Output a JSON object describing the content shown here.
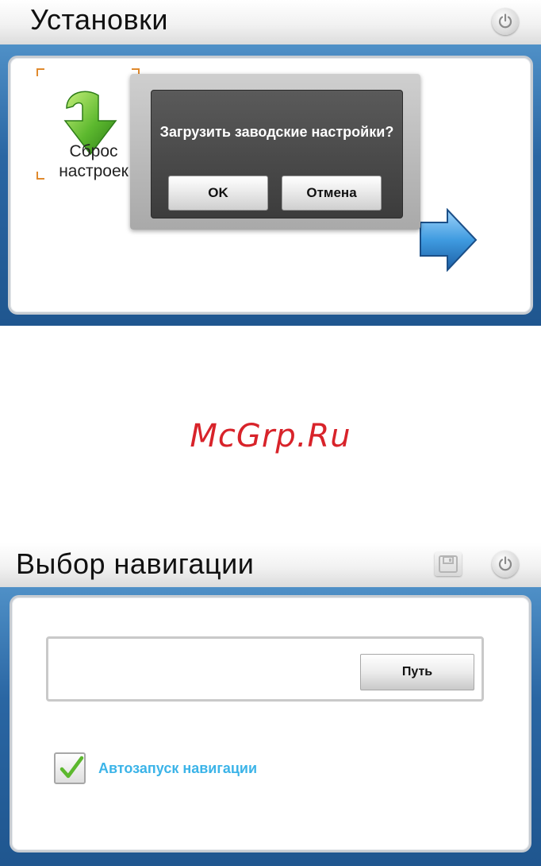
{
  "screen1": {
    "title": "Установки",
    "power_icon": "power-icon",
    "reset_item": {
      "label": "Сброс настроек",
      "icon": "green-down-arrow-icon"
    },
    "next_icon": "blue-right-arrow-icon",
    "dialog": {
      "message": "Загрузить заводские настройки?",
      "ok_label": "OK",
      "cancel_label": "Отмена"
    }
  },
  "watermark": "McGrp.Ru",
  "screen2": {
    "title": "Выбор навигации",
    "save_icon": "save-icon",
    "power_icon": "power-icon",
    "path": {
      "value": "",
      "button_label": "Путь"
    },
    "autostart": {
      "label": "Автозапуск навигации",
      "checked": true
    }
  },
  "colors": {
    "frame_blue": "#2a66a3",
    "dialog_bg": "#4a4a4a",
    "link_blue": "#3cb4e8",
    "watermark_red": "#d8232a",
    "check_green": "#5cb82e"
  }
}
